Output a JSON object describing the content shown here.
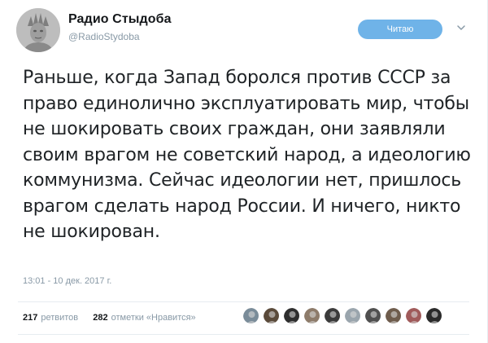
{
  "account": {
    "name": "Радио Стыдоба",
    "handle": "@RadioStydoba",
    "avatar_icon": "liberty-statue-icon"
  },
  "actions": {
    "follow_label": "Читаю",
    "menu_icon": "chevron-down-icon"
  },
  "tweet": {
    "text": "Раньше, когда Запад боролся против СССР за право единолично эксплуатировать мир, чтобы не шокировать своих граждан, они заявляли своим врагом не советский народ, а идеологию коммунизма. Сейчас идеологии нет, пришлось врагом сделать народ России. И ничего, никто не шокирован.",
    "timestamp": "13:01 - 10 дек. 2017 г."
  },
  "stats": {
    "retweets_count": "217",
    "retweets_label": "ретвитов",
    "likes_count": "282",
    "likes_label": "отметки «Нравится»"
  },
  "colors": {
    "follow_button": "#6fb3e8",
    "muted_text": "#8899a6",
    "divider": "#e6ecf0"
  },
  "likers": [
    {
      "name": "liker-avatar-1",
      "color": "#7a8c99"
    },
    {
      "name": "liker-avatar-2",
      "color": "#5a4a3a"
    },
    {
      "name": "liker-avatar-3",
      "color": "#2e2e2e"
    },
    {
      "name": "liker-avatar-4",
      "color": "#8d7b6a"
    },
    {
      "name": "liker-avatar-5",
      "color": "#3b3b3b"
    },
    {
      "name": "liker-avatar-6",
      "color": "#9aa5ad"
    },
    {
      "name": "liker-avatar-7",
      "color": "#4f4f4f"
    },
    {
      "name": "liker-avatar-8",
      "color": "#6e5c4c"
    },
    {
      "name": "liker-avatar-9",
      "color": "#a05a5a"
    },
    {
      "name": "liker-avatar-10",
      "color": "#2a2a2a"
    }
  ]
}
